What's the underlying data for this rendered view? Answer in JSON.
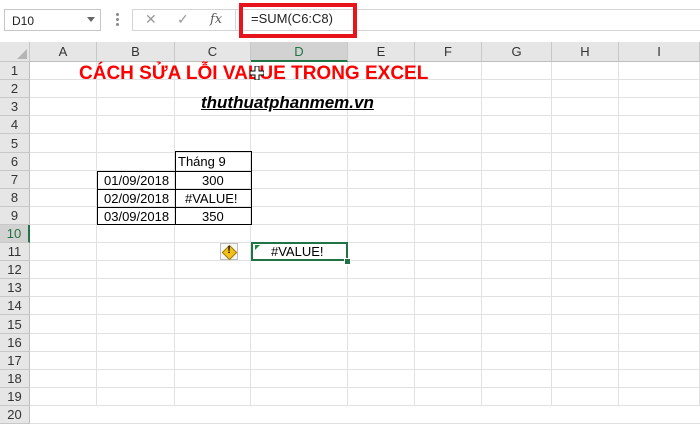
{
  "formula_bar": {
    "name_box": "D10",
    "cancel_glyph": "✕",
    "enter_glyph": "✓",
    "fx_label": "fx",
    "formula": "=SUM(C6:C8)"
  },
  "columns": [
    "A",
    "B",
    "C",
    "D",
    "E",
    "F",
    "G",
    "H",
    "I"
  ],
  "rows": [
    "1",
    "2",
    "3",
    "4",
    "5",
    "6",
    "7",
    "8",
    "9",
    "10",
    "11",
    "12",
    "13",
    "14",
    "15",
    "16",
    "17",
    "18",
    "19",
    "20"
  ],
  "selected": {
    "column": "D",
    "row": "10"
  },
  "cells": {
    "title": "CÁCH SỬA LỖI VALUE TRONG EXCEL",
    "subtitle": "thuthuatphanmem.vn",
    "c5": "Tháng 9",
    "b6": "01/09/2018",
    "c6": "300",
    "b7": "02/09/2018",
    "c7": "#VALUE!",
    "b8": "03/09/2018",
    "c8": "350",
    "d10": "#VALUE!"
  },
  "icons": {
    "error_indicator": "warning-diamond-icon",
    "cursor": "excel-cross-cursor-icon",
    "warning_glyph": "!"
  },
  "colors": {
    "title": "#ff0000",
    "highlight_box": "#e8141c",
    "selection": "#217346"
  }
}
